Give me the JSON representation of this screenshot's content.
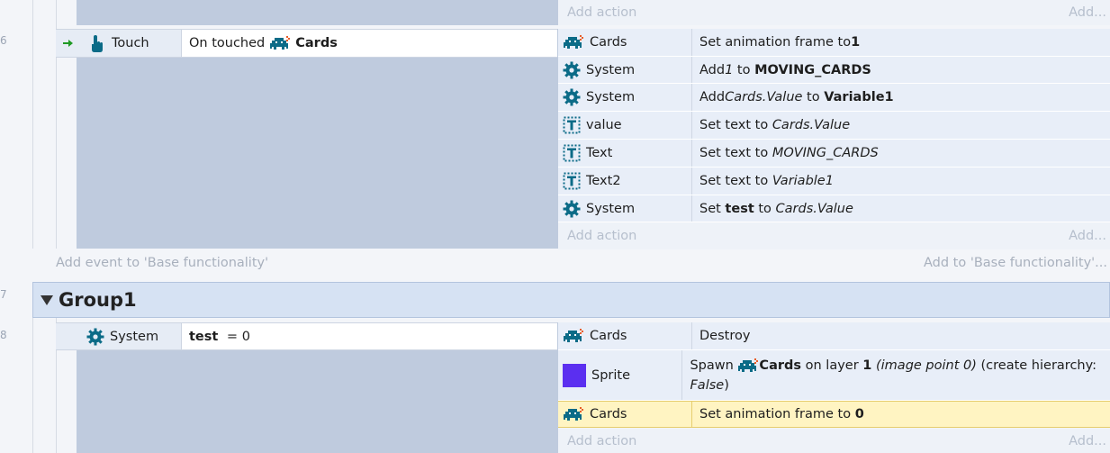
{
  "colors": {
    "block": "#bfcbde",
    "action_row": "#e8eef8",
    "selected": "#fff4c2",
    "group_bar": "#d6e2f3",
    "teal_icon": "#0b6b87",
    "sprite_icon": "#5b2ff0",
    "arrow_green": "#1f9a24"
  },
  "top": {
    "add_action": "Add action",
    "add_more": "Add..."
  },
  "event6": {
    "number": "6",
    "condition": {
      "object": "Touch",
      "text": "On touched",
      "target": "Cards"
    },
    "actions": [
      {
        "object": "Cards",
        "icon": "invader-icon",
        "p1": "Set animation frame to ",
        "b1": "1"
      },
      {
        "object": "System",
        "icon": "gear-icon",
        "p1": "Add ",
        "i1": "1",
        "p2": " to ",
        "b1": "MOVING_CARDS"
      },
      {
        "object": "System",
        "icon": "gear-icon",
        "p1": "Add ",
        "i1": "Cards.Value",
        "p2": " to ",
        "b1": "Variable1"
      },
      {
        "object": "value",
        "icon": "text-object-icon",
        "p1": "Set text to ",
        "i1": "Cards.Value"
      },
      {
        "object": "Text",
        "icon": "text-object-icon",
        "p1": "Set text to ",
        "i1": "MOVING_CARDS"
      },
      {
        "object": "Text2",
        "icon": "text-object-icon",
        "p1": "Set text to ",
        "i1": "Variable1"
      },
      {
        "object": "System",
        "icon": "gear-icon",
        "p1": "Set ",
        "b1": "test",
        "p2": " to ",
        "i1": "Cards.Value"
      }
    ],
    "add_action": "Add action",
    "add_more": "Add..."
  },
  "add_event": "Add event to 'Base functionality'",
  "add_to": "Add to 'Base functionality'...",
  "group": {
    "number": "7",
    "title": "Group1"
  },
  "event8": {
    "number": "8",
    "condition": {
      "object": "System",
      "var": "test",
      "op": " = 0"
    },
    "actions": {
      "a1": {
        "object": "Cards",
        "text": "Destroy"
      },
      "a2": {
        "object": "Sprite",
        "p1": "Spawn ",
        "target": "Cards",
        "p2": " on layer ",
        "layer": "1",
        "i1": "(image point 0)",
        "p3": " (create hierarchy:",
        "i2": "False",
        "p4": ")"
      },
      "a3": {
        "object": "Cards",
        "p1": "Set animation frame to ",
        "b1": "0"
      }
    },
    "add_action": "Add action",
    "add_more": "Add..."
  }
}
